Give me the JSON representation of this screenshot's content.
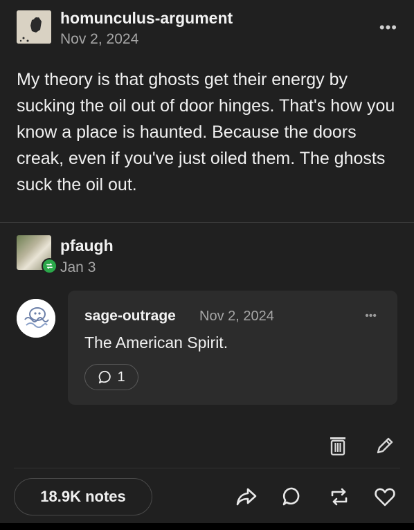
{
  "post": {
    "username": "homunculus-argument",
    "date": "Nov 2, 2024",
    "menu_label": "•••",
    "body": "My theory is that ghosts get their energy by sucking the oil out of door hinges. That's how you know a place is haunted. Because the doors creak, even if you've just oiled them. The ghosts suck the oil out."
  },
  "reblog": {
    "username": "pfaugh",
    "date": "Jan 3"
  },
  "comment": {
    "username": "sage-outrage",
    "date": "Nov 2, 2024",
    "menu_label": "•••",
    "text": "The American Spirit.",
    "reply_count": "1"
  },
  "footer": {
    "notes_label": "18.9K notes"
  },
  "colors": {
    "background": "#202020",
    "card": "#2c2c2c",
    "reblog_badge": "#2ba84a",
    "muted_text": "#a6a6a6"
  },
  "icons": {
    "post_tools": [
      "trash-icon",
      "edit-icon"
    ],
    "actions": [
      "share-icon",
      "reply-icon",
      "reblog-icon",
      "like-icon"
    ]
  }
}
